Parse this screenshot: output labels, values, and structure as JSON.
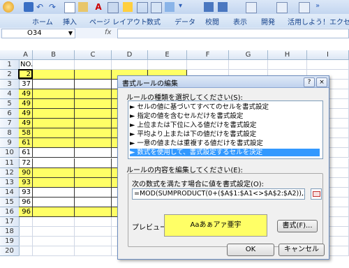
{
  "ribbon": {
    "tabs": [
      "ホーム",
      "挿入",
      "ページ レイアウト",
      "数式",
      "データ",
      "校閲",
      "表示",
      "開発",
      "活用しよう！エクセル"
    ]
  },
  "formula_bar": {
    "name_box": "O34",
    "fx_label": "fx"
  },
  "sheet": {
    "columns": [
      "A",
      "B",
      "C",
      "D",
      "E",
      "F",
      "G",
      "H",
      "I"
    ],
    "rows": [
      "1",
      "2",
      "3",
      "4",
      "5",
      "6",
      "7",
      "8",
      "9",
      "10",
      "11",
      "12",
      "13",
      "14",
      "15",
      "16",
      "17",
      "18",
      "19",
      "20"
    ],
    "a_values": [
      "NO.",
      "2",
      "37",
      "49",
      "49",
      "49",
      "49",
      "58",
      "61",
      "61",
      "72",
      "90",
      "93",
      "93",
      "96",
      "96",
      "",
      "",
      "",
      ""
    ],
    "highlight_color": "#ffff66"
  },
  "dialog": {
    "title": "書式ルールの編集",
    "help": "?",
    "close": "×",
    "select_type_label": "ルールの種類を選択してください(S):",
    "rule_types": [
      "► セルの値に基づいてすべてのセルを書式設定",
      "► 指定の値を含むセルだけを書式設定",
      "► 上位または下位に入る値だけを書式設定",
      "► 平均より上または下の値だけを書式設定",
      "► 一意の値または重複する値だけを書式設定",
      "► 数式を使用して、書式設定するセルを決定"
    ],
    "edit_desc_label": "ルールの内容を編集してください(E):",
    "formula_label": "次の数式を満たす場合に値を書式設定(O):",
    "formula_value": "=MOD(SUMPRODUCT(0+($A$1:$A1<>$A$2:$A2)),2)",
    "preview_label": "プレビュー:",
    "preview_text": "Aaあぁアァ亜宇",
    "format_button": "書式(F)...",
    "ok_button": "OK",
    "cancel_button": "キャンセル"
  }
}
